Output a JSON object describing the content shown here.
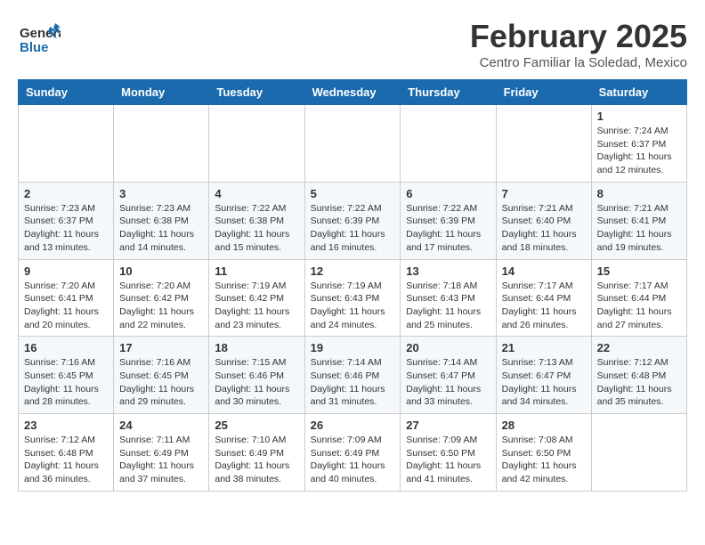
{
  "header": {
    "logo_general": "General",
    "logo_blue": "Blue",
    "month_year": "February 2025",
    "location": "Centro Familiar la Soledad, Mexico"
  },
  "days_of_week": [
    "Sunday",
    "Monday",
    "Tuesday",
    "Wednesday",
    "Thursday",
    "Friday",
    "Saturday"
  ],
  "weeks": [
    [
      {
        "day": "",
        "info": ""
      },
      {
        "day": "",
        "info": ""
      },
      {
        "day": "",
        "info": ""
      },
      {
        "day": "",
        "info": ""
      },
      {
        "day": "",
        "info": ""
      },
      {
        "day": "",
        "info": ""
      },
      {
        "day": "1",
        "info": "Sunrise: 7:24 AM\nSunset: 6:37 PM\nDaylight: 11 hours and 12 minutes."
      }
    ],
    [
      {
        "day": "2",
        "info": "Sunrise: 7:23 AM\nSunset: 6:37 PM\nDaylight: 11 hours and 13 minutes."
      },
      {
        "day": "3",
        "info": "Sunrise: 7:23 AM\nSunset: 6:38 PM\nDaylight: 11 hours and 14 minutes."
      },
      {
        "day": "4",
        "info": "Sunrise: 7:22 AM\nSunset: 6:38 PM\nDaylight: 11 hours and 15 minutes."
      },
      {
        "day": "5",
        "info": "Sunrise: 7:22 AM\nSunset: 6:39 PM\nDaylight: 11 hours and 16 minutes."
      },
      {
        "day": "6",
        "info": "Sunrise: 7:22 AM\nSunset: 6:39 PM\nDaylight: 11 hours and 17 minutes."
      },
      {
        "day": "7",
        "info": "Sunrise: 7:21 AM\nSunset: 6:40 PM\nDaylight: 11 hours and 18 minutes."
      },
      {
        "day": "8",
        "info": "Sunrise: 7:21 AM\nSunset: 6:41 PM\nDaylight: 11 hours and 19 minutes."
      }
    ],
    [
      {
        "day": "9",
        "info": "Sunrise: 7:20 AM\nSunset: 6:41 PM\nDaylight: 11 hours and 20 minutes."
      },
      {
        "day": "10",
        "info": "Sunrise: 7:20 AM\nSunset: 6:42 PM\nDaylight: 11 hours and 22 minutes."
      },
      {
        "day": "11",
        "info": "Sunrise: 7:19 AM\nSunset: 6:42 PM\nDaylight: 11 hours and 23 minutes."
      },
      {
        "day": "12",
        "info": "Sunrise: 7:19 AM\nSunset: 6:43 PM\nDaylight: 11 hours and 24 minutes."
      },
      {
        "day": "13",
        "info": "Sunrise: 7:18 AM\nSunset: 6:43 PM\nDaylight: 11 hours and 25 minutes."
      },
      {
        "day": "14",
        "info": "Sunrise: 7:17 AM\nSunset: 6:44 PM\nDaylight: 11 hours and 26 minutes."
      },
      {
        "day": "15",
        "info": "Sunrise: 7:17 AM\nSunset: 6:44 PM\nDaylight: 11 hours and 27 minutes."
      }
    ],
    [
      {
        "day": "16",
        "info": "Sunrise: 7:16 AM\nSunset: 6:45 PM\nDaylight: 11 hours and 28 minutes."
      },
      {
        "day": "17",
        "info": "Sunrise: 7:16 AM\nSunset: 6:45 PM\nDaylight: 11 hours and 29 minutes."
      },
      {
        "day": "18",
        "info": "Sunrise: 7:15 AM\nSunset: 6:46 PM\nDaylight: 11 hours and 30 minutes."
      },
      {
        "day": "19",
        "info": "Sunrise: 7:14 AM\nSunset: 6:46 PM\nDaylight: 11 hours and 31 minutes."
      },
      {
        "day": "20",
        "info": "Sunrise: 7:14 AM\nSunset: 6:47 PM\nDaylight: 11 hours and 33 minutes."
      },
      {
        "day": "21",
        "info": "Sunrise: 7:13 AM\nSunset: 6:47 PM\nDaylight: 11 hours and 34 minutes."
      },
      {
        "day": "22",
        "info": "Sunrise: 7:12 AM\nSunset: 6:48 PM\nDaylight: 11 hours and 35 minutes."
      }
    ],
    [
      {
        "day": "23",
        "info": "Sunrise: 7:12 AM\nSunset: 6:48 PM\nDaylight: 11 hours and 36 minutes."
      },
      {
        "day": "24",
        "info": "Sunrise: 7:11 AM\nSunset: 6:49 PM\nDaylight: 11 hours and 37 minutes."
      },
      {
        "day": "25",
        "info": "Sunrise: 7:10 AM\nSunset: 6:49 PM\nDaylight: 11 hours and 38 minutes."
      },
      {
        "day": "26",
        "info": "Sunrise: 7:09 AM\nSunset: 6:49 PM\nDaylight: 11 hours and 40 minutes."
      },
      {
        "day": "27",
        "info": "Sunrise: 7:09 AM\nSunset: 6:50 PM\nDaylight: 11 hours and 41 minutes."
      },
      {
        "day": "28",
        "info": "Sunrise: 7:08 AM\nSunset: 6:50 PM\nDaylight: 11 hours and 42 minutes."
      },
      {
        "day": "",
        "info": ""
      }
    ]
  ]
}
